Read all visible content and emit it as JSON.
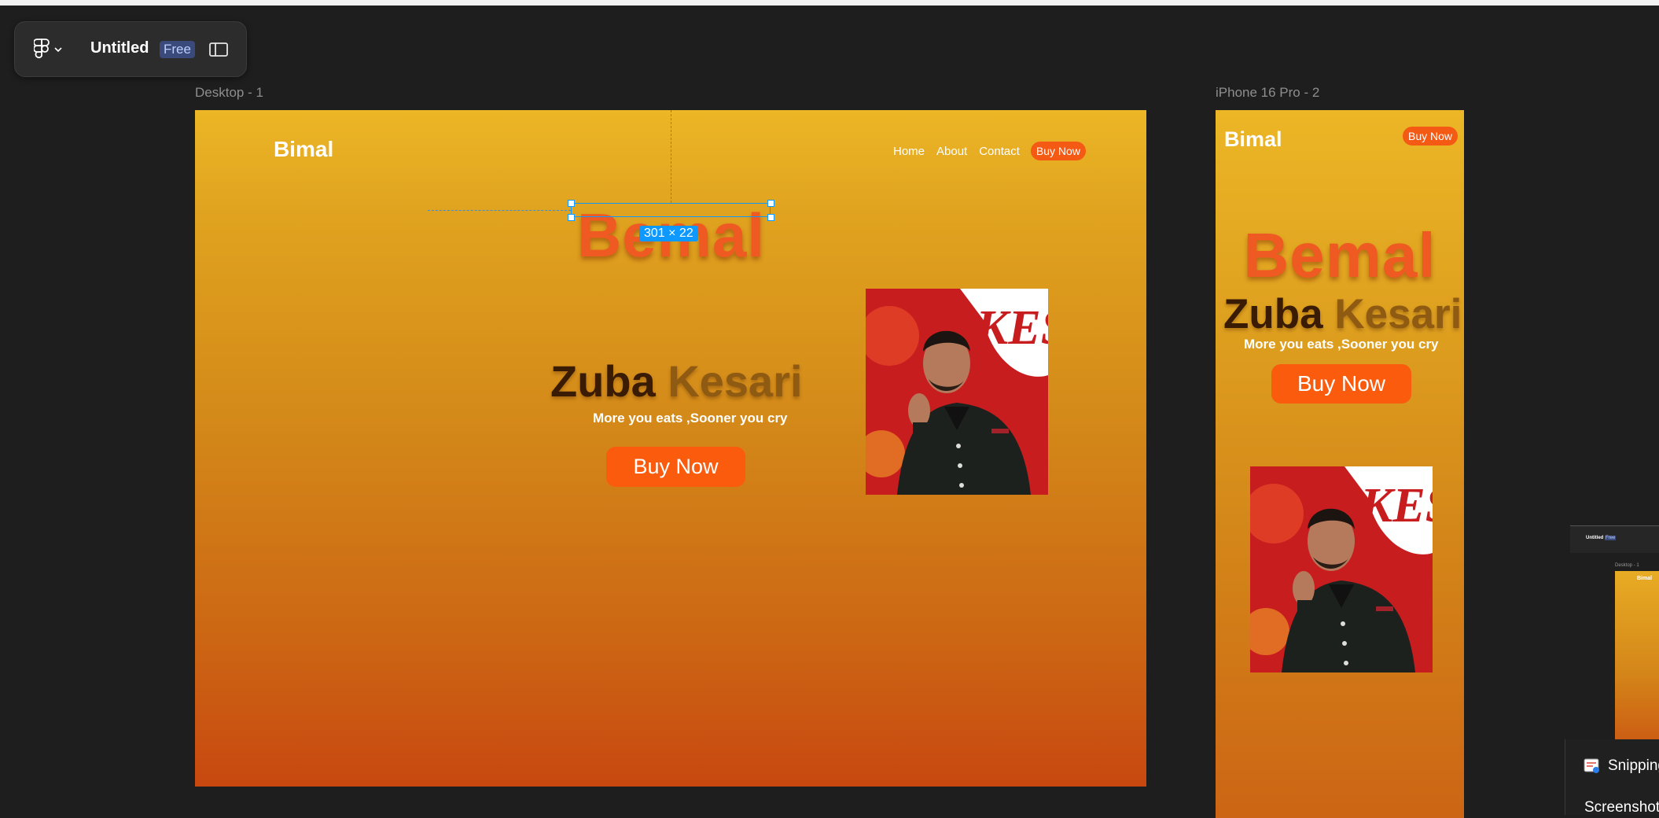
{
  "app": {
    "file_title": "Untitled",
    "plan_badge": "Free"
  },
  "frames": {
    "desktop_label": "Desktop - 1",
    "phone_label": "iPhone 16 Pro - 2"
  },
  "site": {
    "logo": "Bimal",
    "nav": [
      "Home",
      "About",
      "Contact"
    ],
    "nav_buy": "Buy Now",
    "brand": "Bemal",
    "headline_1": "Zuba",
    "headline_2": "Kesari",
    "tagline": "More you eats ,Sooner you cry",
    "cta": "Buy Now",
    "photo_text": "KES"
  },
  "selection": {
    "dimensions": "301 × 22"
  },
  "taskbar": {
    "snipping_label": "Snipping Tool",
    "screenshot_label": "Screenshot",
    "mini_title": "Untitled",
    "mini_badge": "Free",
    "mini_frame_label": "Desktop - 1",
    "mini_logo": "Bimal"
  },
  "colors": {
    "selection": "#0d99ff",
    "brand_orange": "#ee5a22",
    "cta": "#fa5b0c"
  }
}
